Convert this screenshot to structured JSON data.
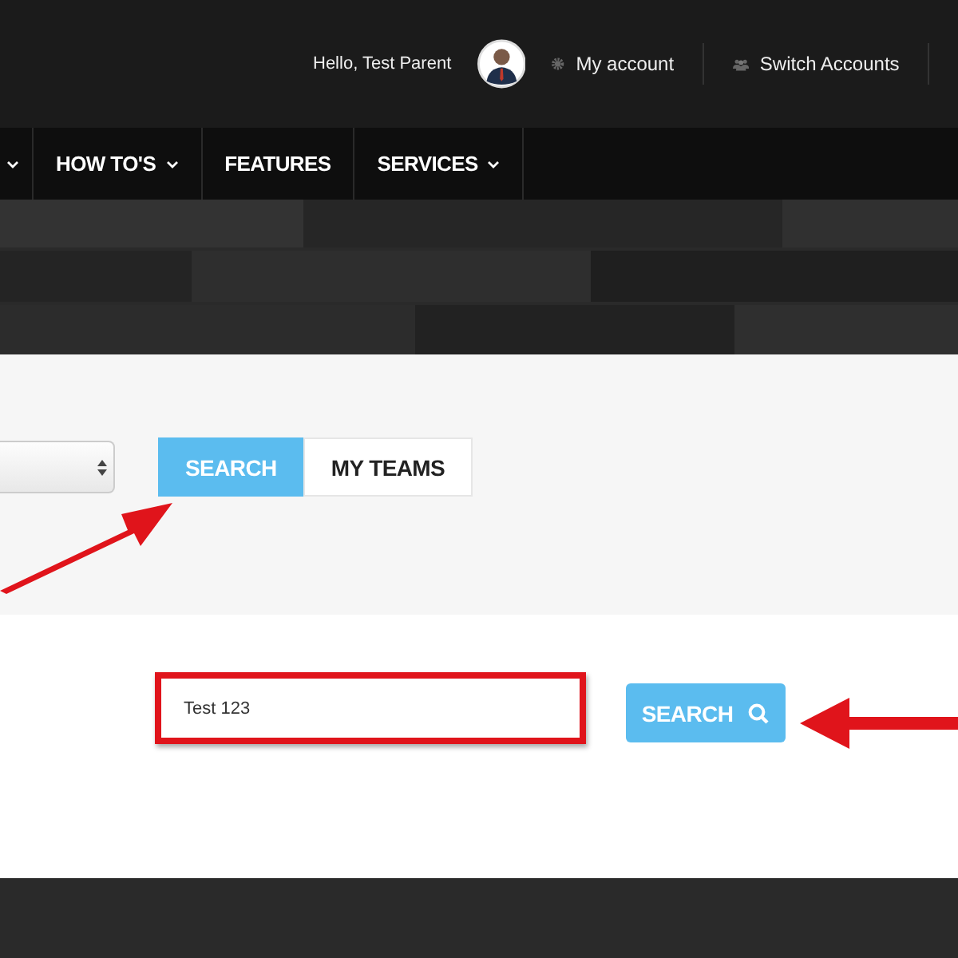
{
  "header": {
    "greeting": "Hello, Test Parent",
    "links": [
      {
        "label": "My account"
      },
      {
        "label": "Switch Accounts"
      }
    ]
  },
  "nav": {
    "items": [
      {
        "has_menu": true
      },
      {
        "label": "HOW TO'S",
        "has_menu": true
      },
      {
        "label": "FEATURES",
        "has_menu": false
      },
      {
        "label": "SERVICES",
        "has_menu": true
      }
    ]
  },
  "tabs": [
    {
      "label": "SEARCH",
      "selected": true
    },
    {
      "label": "MY TEAMS",
      "selected": false
    }
  ],
  "search": {
    "value": "Test 123",
    "button": "SEARCH"
  }
}
